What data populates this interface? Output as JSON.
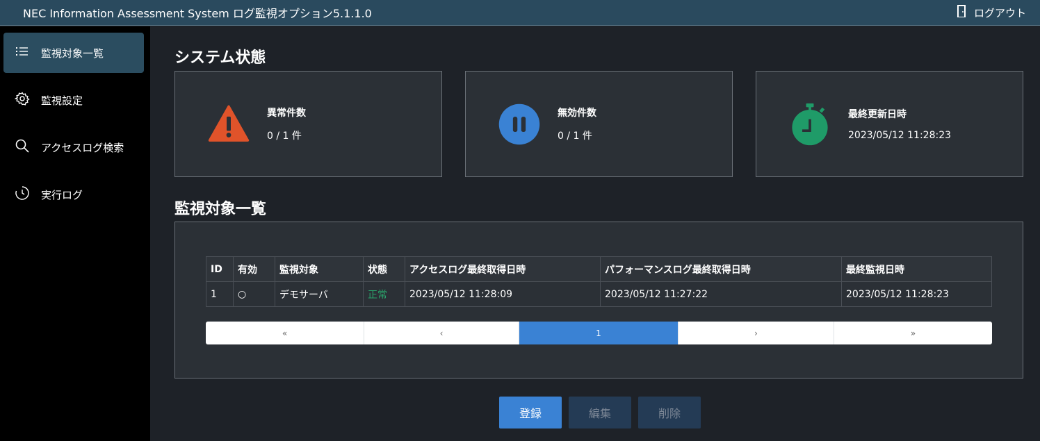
{
  "header": {
    "title": "NEC Information Assessment System ログ監視オプション5.1.1.0",
    "logout_label": "ログアウト"
  },
  "sidebar": {
    "items": [
      {
        "label": "監視対象一覧",
        "icon": "list-icon",
        "active": true
      },
      {
        "label": "監視設定",
        "icon": "gear-icon",
        "active": false
      },
      {
        "label": "アクセスログ検索",
        "icon": "search-icon",
        "active": false
      },
      {
        "label": "実行ログ",
        "icon": "history-clock-icon",
        "active": false
      }
    ]
  },
  "system_status": {
    "title": "システム状態",
    "cards": [
      {
        "label": "異常件数",
        "value": "0 / 1 件",
        "icon": "warning-triangle-icon",
        "color": "#e0532a"
      },
      {
        "label": "無効件数",
        "value": "0 / 1 件",
        "icon": "pause-circle-icon",
        "color": "#3a82d4"
      },
      {
        "label": "最終更新日時",
        "value": "2023/05/12 11:28:23",
        "icon": "stopwatch-icon",
        "color": "#1f9b68"
      }
    ]
  },
  "monitor_list": {
    "title": "監視対象一覧",
    "columns": [
      "ID",
      "有効",
      "監視対象",
      "状態",
      "アクセスログ最終取得日時",
      "パフォーマンスログ最終取得日時",
      "最終監視日時"
    ],
    "rows": [
      [
        "1",
        "○",
        "デモサーバ",
        "正常",
        "2023/05/12 11:28:09",
        "2023/05/12 11:27:22",
        "2023/05/12 11:28:23"
      ]
    ],
    "status_ok_color": "#2aa36b"
  },
  "pagination": {
    "first": "«",
    "prev": "‹",
    "current": "1",
    "next": "›",
    "last": "»"
  },
  "actions": {
    "register": "登録",
    "edit": "編集",
    "delete": "削除"
  }
}
